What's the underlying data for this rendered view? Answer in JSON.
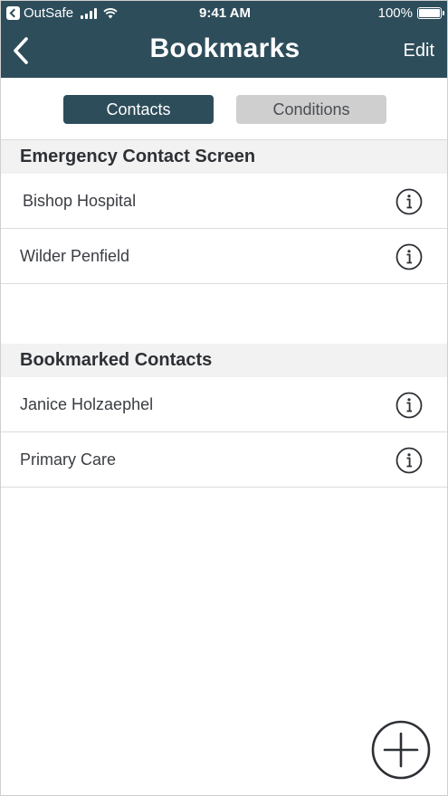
{
  "status_bar": {
    "carrier": "OutSafe",
    "time": "9:41 AM",
    "battery": "100%"
  },
  "nav": {
    "title": "Bookmarks",
    "edit_label": "Edit",
    "back_icon": "chevron-left-icon"
  },
  "tabs": [
    {
      "label": "Contacts",
      "selected": true
    },
    {
      "label": "Conditions",
      "selected": false
    }
  ],
  "sections": [
    {
      "title": "Emergency Contact Screen",
      "items": [
        {
          "label": "Bishop Hospital",
          "icon": "info-icon"
        },
        {
          "label": "Wilder Penfield",
          "icon": "info-icon"
        }
      ]
    },
    {
      "title": "Bookmarked Contacts",
      "items": [
        {
          "label": "Janice Holzaephel",
          "icon": "info-icon"
        },
        {
          "label": "Primary Care",
          "icon": "info-icon"
        }
      ]
    }
  ],
  "add_button": {
    "icon": "plus-circle-icon"
  },
  "colors": {
    "header": "#2e4d5b",
    "tab_selected": "#2e4d5b",
    "tab_unselected": "#cfcfcf",
    "section_bg": "#f2f2f2"
  }
}
